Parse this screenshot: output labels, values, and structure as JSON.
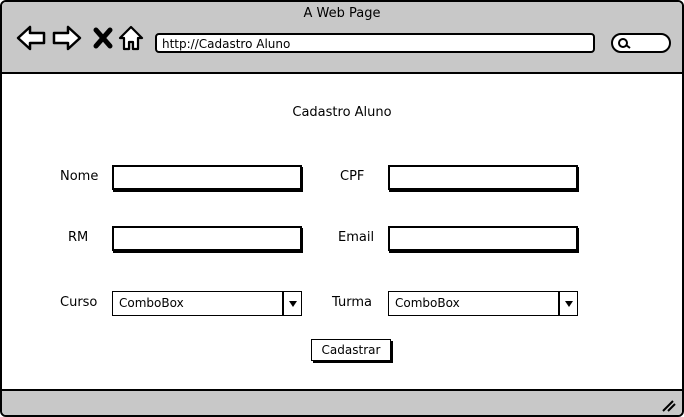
{
  "window": {
    "title": "A Web Page"
  },
  "toolbar": {
    "url": "http://Cadastro Aluno",
    "icons": [
      "back-arrow-icon",
      "forward-arrow-icon",
      "close-icon",
      "home-icon",
      "search-icon"
    ]
  },
  "form": {
    "title": "Cadastro Aluno",
    "fields": {
      "nome": {
        "label": "Nome",
        "value": ""
      },
      "cpf": {
        "label": "CPF",
        "value": ""
      },
      "rm": {
        "label": "RM",
        "value": ""
      },
      "email": {
        "label": "Email",
        "value": ""
      },
      "curso": {
        "label": "Curso",
        "selected": "ComboBox"
      },
      "turma": {
        "label": "Turma",
        "selected": "ComboBox"
      }
    },
    "submit_label": "Cadastrar"
  }
}
